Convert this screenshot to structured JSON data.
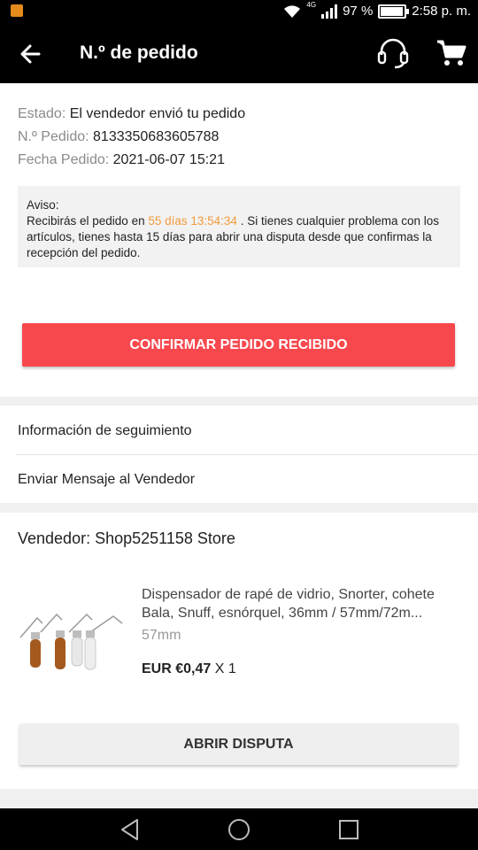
{
  "status_bar": {
    "network": "4G",
    "battery": "97 %",
    "time": "2:58 p. m."
  },
  "header": {
    "title": "N.º de pedido",
    "back_icon": "arrow-left-icon",
    "support_icon": "headset-icon",
    "cart_icon": "cart-icon"
  },
  "order": {
    "status_label": "Estado:",
    "status_value": "El vendedor envió tu pedido",
    "number_label": "N.º Pedido:",
    "number_value": "8133350683605788",
    "date_label": "Fecha Pedido:",
    "date_value": "2021-06-07 15:21"
  },
  "notice": {
    "title": "Aviso:",
    "text_before": "Recibirás el pedido en ",
    "countdown": "55 días 13:54:34",
    "text_after": " . Si tienes cualquier problema con los artículos, tienes hasta 15 días para abrir una disputa desde que confirmas la recepción del pedido.",
    "highlight_color": "#f29b3c"
  },
  "confirm_button": "CONFIRMAR PEDIDO RECIBIDO",
  "links": {
    "tracking": "Información de seguimiento",
    "message_seller": "Enviar Mensaje al Vendedor"
  },
  "seller": {
    "label": "Vendedor: Shop5251158 Store"
  },
  "product": {
    "title": "Dispensador de rapé de vidrio, Snorter, cohete Bala, Snuff, esnórquel, 36mm / 57mm/72m...",
    "variant": "57mm",
    "price": "EUR €0,47",
    "quantity": "X 1"
  },
  "dispute_button": "ABRIR DISPUTA",
  "colors": {
    "accent": "#f7484e",
    "header_bg": "#000000"
  }
}
